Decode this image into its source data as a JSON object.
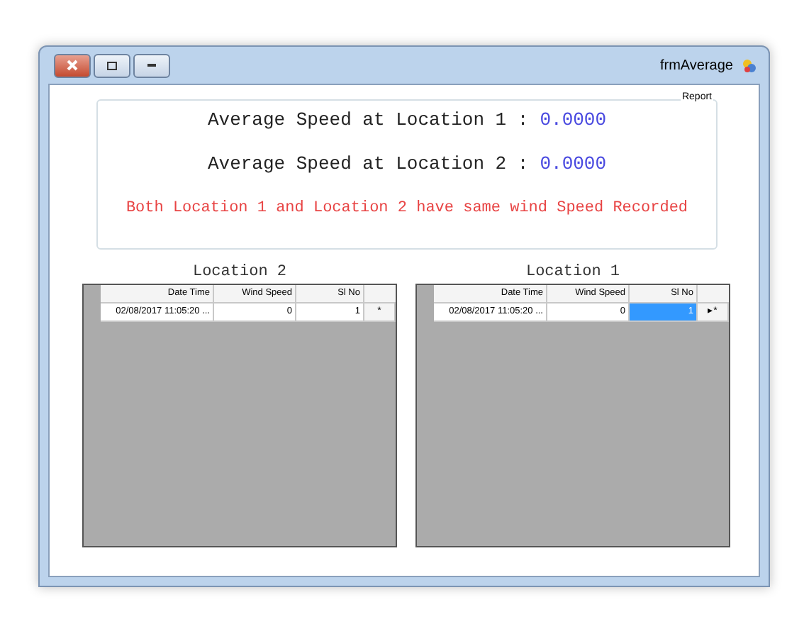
{
  "window": {
    "title": "frmAverage"
  },
  "report": {
    "title": "Report",
    "lines": [
      {
        "label": "Average Speed at Location 1 :",
        "value": "0.0000"
      },
      {
        "label": "Average Speed at Location 2 :",
        "value": "0.0000"
      }
    ],
    "message": "Both Location 1  and Location 2 have same wind Speed Recorded"
  },
  "grids": [
    {
      "title": "Location 2",
      "columns": [
        "Date Time",
        "Wind Speed",
        "Sl No"
      ],
      "rows": [
        {
          "marker": "*",
          "cells": [
            {
              "text": "02/08/2017 11:05:20 ...",
              "selected": false
            },
            {
              "text": "0",
              "selected": false
            },
            {
              "text": "1",
              "selected": false
            }
          ]
        }
      ]
    },
    {
      "title": "Location 1",
      "columns": [
        "Date Time",
        "Wind Speed",
        "Sl No"
      ],
      "rows": [
        {
          "marker": "▸*",
          "cells": [
            {
              "text": "02/08/2017 11:05:20 ...",
              "selected": false
            },
            {
              "text": "0",
              "selected": false
            },
            {
              "text": "1",
              "selected": true
            }
          ]
        }
      ]
    }
  ]
}
